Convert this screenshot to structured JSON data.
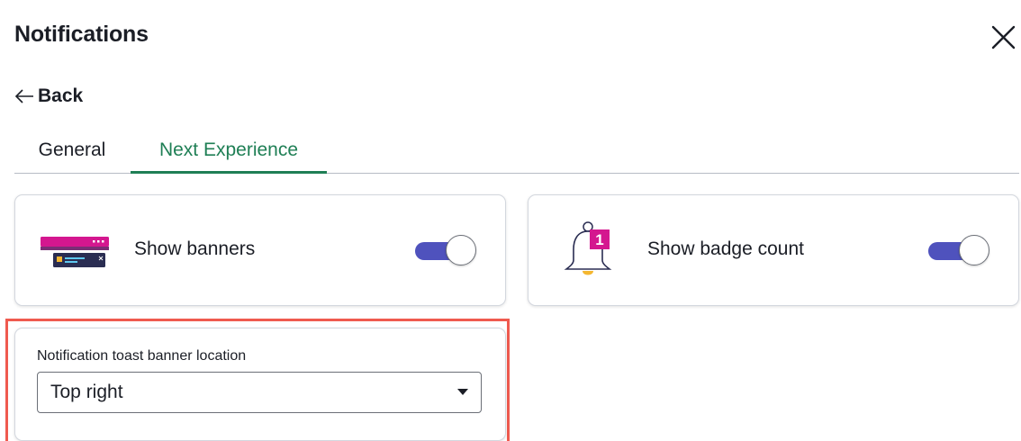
{
  "header": {
    "title": "Notifications",
    "close_icon": "close-icon"
  },
  "nav": {
    "back_label": "Back",
    "back_icon": "arrow-left-icon"
  },
  "tabs": [
    {
      "label": "General",
      "selected": false
    },
    {
      "label": "Next Experience",
      "selected": true
    }
  ],
  "cards": {
    "banners": {
      "label": "Show banners",
      "icon": "banner-illustration-icon",
      "toggle_on": true
    },
    "badge": {
      "label": "Show badge count",
      "icon": "bell-badge-icon",
      "badge_value": "1",
      "toggle_on": true
    }
  },
  "location": {
    "label": "Notification toast banner location",
    "selected_value": "Top right"
  },
  "colors": {
    "accent_tab": "#1f7f55",
    "toggle_on": "#4f52bd",
    "highlight": "#ef5a4f",
    "badge": "#d4178f"
  }
}
